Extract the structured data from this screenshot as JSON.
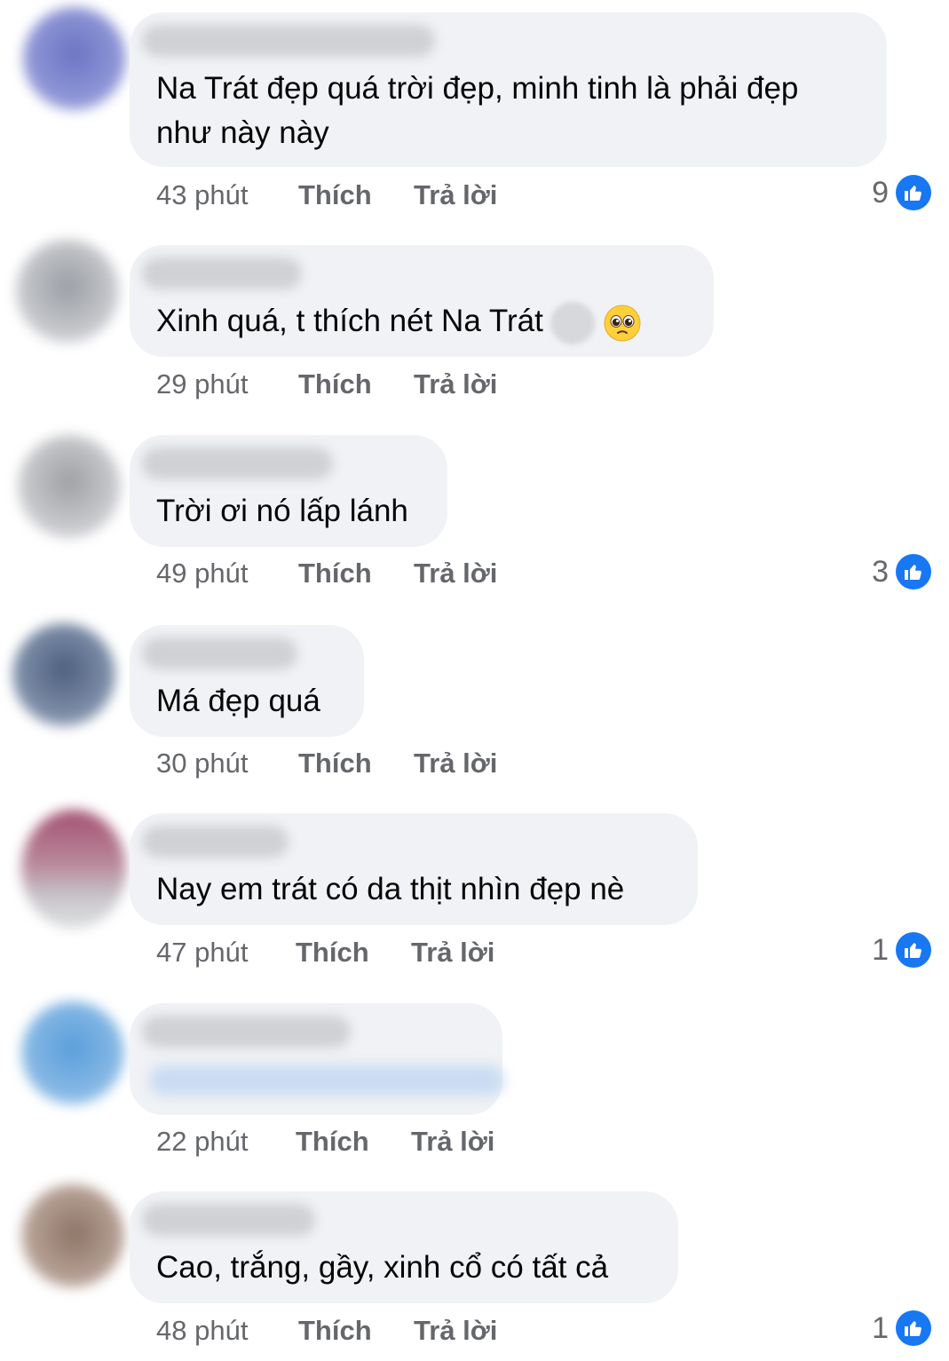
{
  "comments": [
    {
      "text_lines": [
        "Na Trát đẹp quá trời đẹp, minh tinh là phải đẹp",
        "như này này"
      ],
      "time": "43 phút",
      "like_label": "Thích",
      "reply_label": "Trả lời",
      "reaction_count": "9"
    },
    {
      "text_lines": [
        "Xinh quá, t thích nét Na Trát"
      ],
      "time": "29 phút",
      "like_label": "Thích",
      "reply_label": "Trả lời",
      "emoji": [
        "blurred-emoji",
        "pleading-face-icon"
      ]
    },
    {
      "text_lines": [
        "Trời ơi nó lấp lánh"
      ],
      "time": "49 phút",
      "like_label": "Thích",
      "reply_label": "Trả lời",
      "reaction_count": "3"
    },
    {
      "text_lines": [
        "Má đẹp quá"
      ],
      "time": "30 phút",
      "like_label": "Thích",
      "reply_label": "Trả lời"
    },
    {
      "text_lines": [
        "Nay em trát có da thịt nhìn đẹp nè"
      ],
      "time": "47 phút",
      "like_label": "Thích",
      "reply_label": "Trả lời",
      "reaction_count": "1"
    },
    {
      "text_lines": [],
      "time": "22 phút",
      "like_label": "Thích",
      "reply_label": "Trả lời"
    },
    {
      "text_lines": [
        "Cao, trắng, gầy, xinh cổ có tất cả"
      ],
      "time": "48 phút",
      "like_label": "Thích",
      "reply_label": "Trả lời",
      "reaction_count": "1"
    }
  ],
  "colors": {
    "bubble": "#f0f2f5",
    "meta_text": "#65676b",
    "like_blue": "#1877f2"
  },
  "icons": [
    "thumbs-up-icon",
    "pleading-face-icon"
  ]
}
